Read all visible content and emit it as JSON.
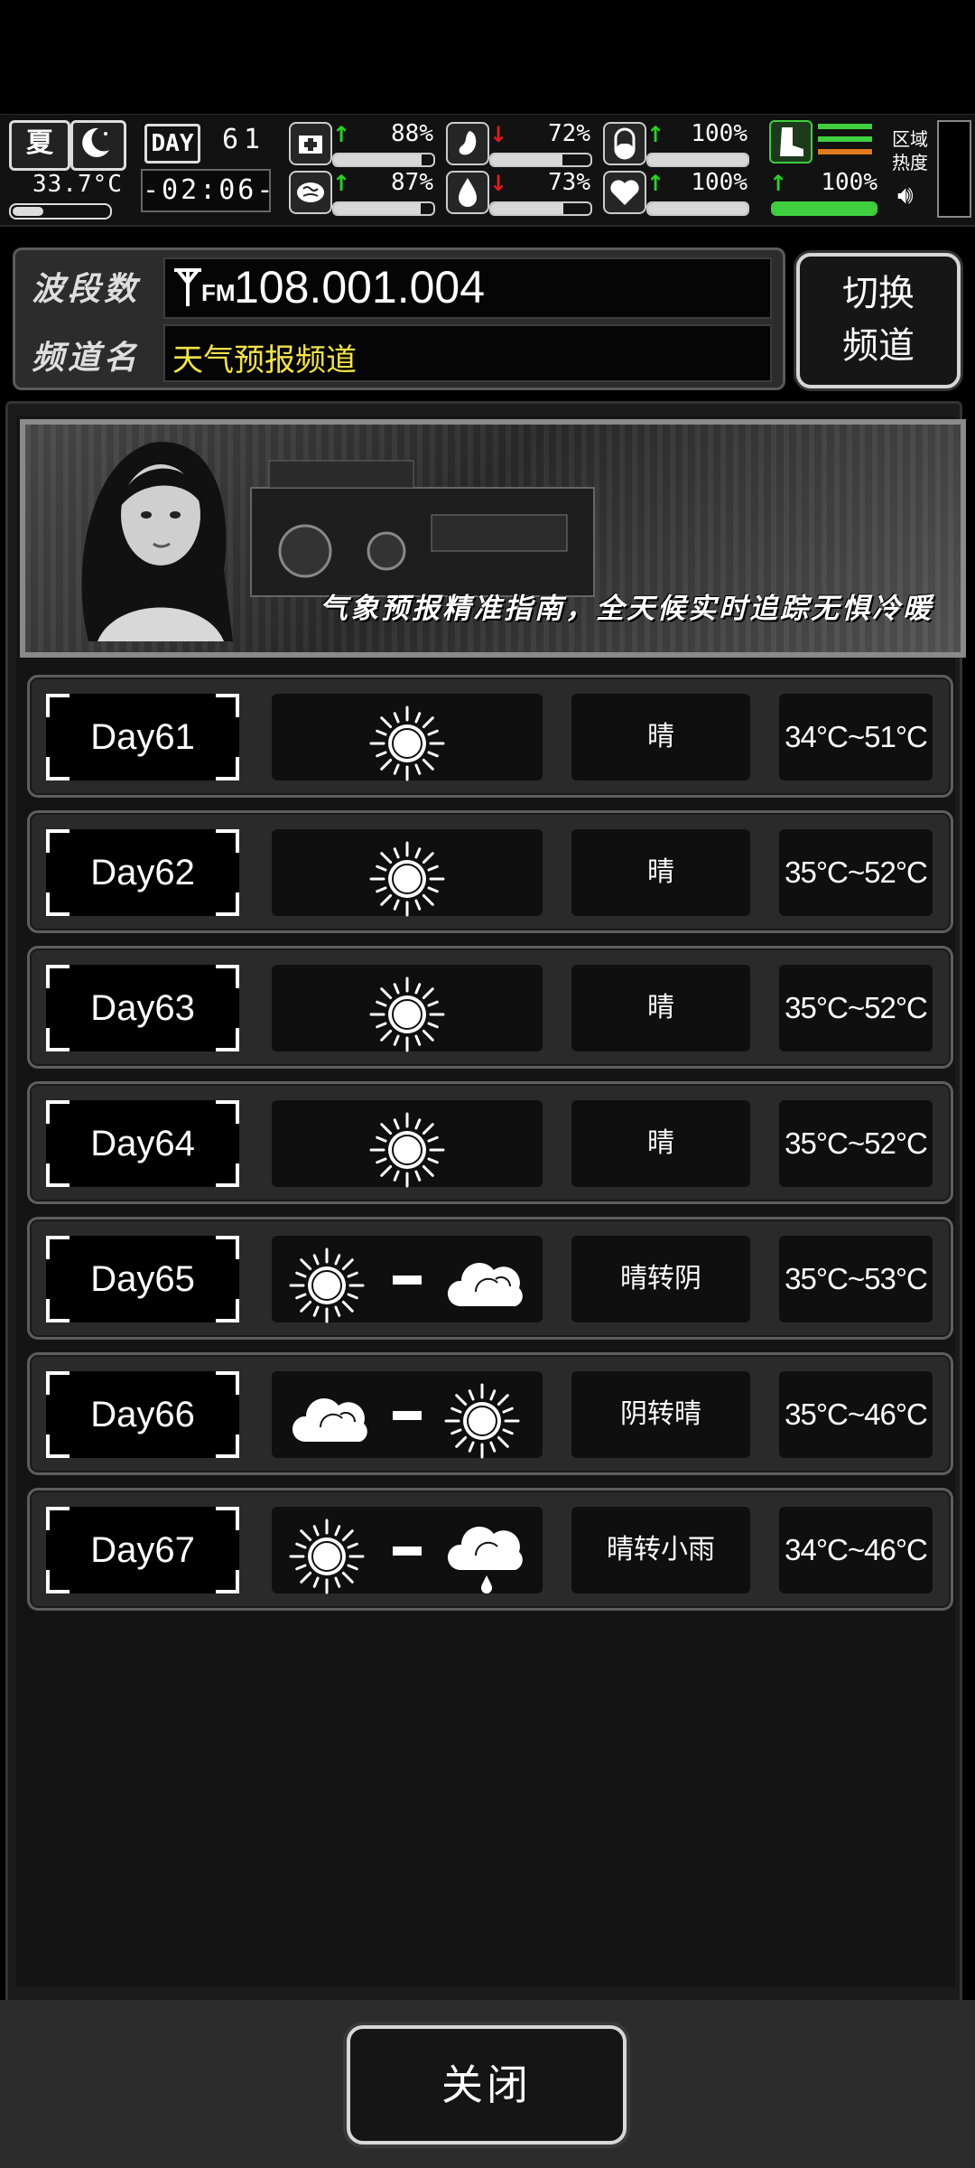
{
  "status": {
    "season": "夏",
    "temperature": "33.7°C",
    "day_label": "DAY",
    "day_number": "61",
    "clock": "-02:06-",
    "region_label_line1": "区域",
    "region_label_line2": "热度",
    "stats": [
      {
        "icon": "medkit-icon",
        "trend": "↑",
        "percent": "88%",
        "fill": 0.88
      },
      {
        "icon": "stomach-icon",
        "trend": "↓",
        "percent": "72%",
        "fill": 0.72
      },
      {
        "icon": "pill-icon",
        "trend": "↑",
        "percent": "100%",
        "fill": 1.0
      },
      {
        "icon": "boot-icon",
        "trend": "",
        "percent": "",
        "fill": 1.0
      },
      {
        "icon": "brain-icon",
        "trend": "↑",
        "percent": "87%",
        "fill": 0.87
      },
      {
        "icon": "water-drop-icon",
        "trend": "↓",
        "percent": "73%",
        "fill": 0.73
      },
      {
        "icon": "heart-icon",
        "trend": "↑",
        "percent": "100%",
        "fill": 1.0
      },
      {
        "icon": "stamina-icon",
        "trend": "↑",
        "percent": "100%",
        "fill": 1.0
      }
    ]
  },
  "radio": {
    "band_label": "波段数",
    "band_value": "108.001.004",
    "fm_label": "FM",
    "channel_label": "频道名",
    "channel_value": "天气预报频道",
    "switch_button_line1": "切换",
    "switch_button_line2": "频道"
  },
  "banner": {
    "slogan": "气象预报精准指南，全天候实时追踪无惧冷暖"
  },
  "forecast": [
    {
      "day": "Day61",
      "weather": [
        "sun"
      ],
      "desc": "晴",
      "temp": "34°C~51°C"
    },
    {
      "day": "Day62",
      "weather": [
        "sun"
      ],
      "desc": "晴",
      "temp": "35°C~52°C"
    },
    {
      "day": "Day63",
      "weather": [
        "sun"
      ],
      "desc": "晴",
      "temp": "35°C~52°C"
    },
    {
      "day": "Day64",
      "weather": [
        "sun"
      ],
      "desc": "晴",
      "temp": "35°C~52°C"
    },
    {
      "day": "Day65",
      "weather": [
        "sun",
        "cloud"
      ],
      "desc": "晴转阴",
      "temp": "35°C~53°C"
    },
    {
      "day": "Day66",
      "weather": [
        "cloud",
        "sun"
      ],
      "desc": "阴转晴",
      "temp": "35°C~46°C"
    },
    {
      "day": "Day67",
      "weather": [
        "sun",
        "rain"
      ],
      "desc": "晴转小雨",
      "temp": "34°C~46°C"
    }
  ],
  "close_button": "关闭",
  "colors": {
    "trend_up": "#27d427",
    "trend_down": "#e01c1c",
    "channel_text": "#f2e24a",
    "stamina_green": "#3fcf3f"
  }
}
